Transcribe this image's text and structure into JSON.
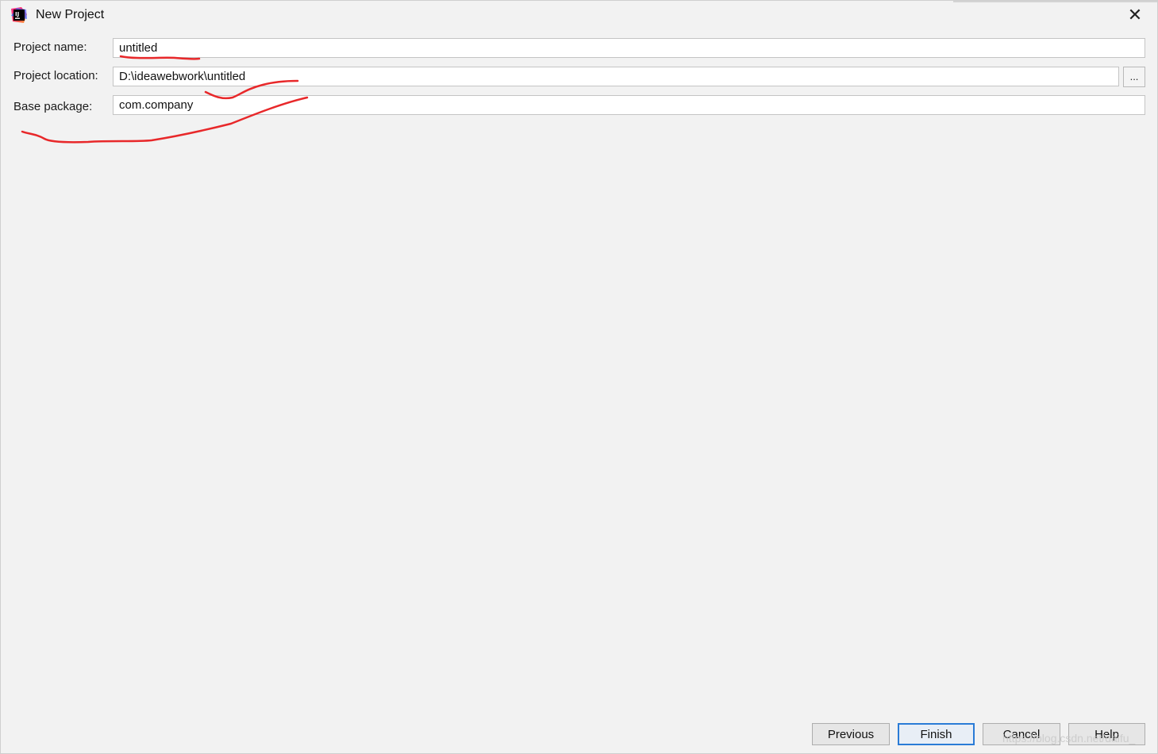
{
  "window": {
    "title": "New Project",
    "close_glyph": "✕"
  },
  "form": {
    "project_name": {
      "label": "Project name:",
      "value": "untitled"
    },
    "project_location": {
      "label": "Project location:",
      "value": "D:\\ideawebwork\\untitled",
      "browse_label": "..."
    },
    "base_package": {
      "label": "Base package:",
      "value": "com.company"
    }
  },
  "buttons": {
    "previous": "Previous",
    "finish": "Finish",
    "cancel": "Cancel",
    "help": "Help"
  },
  "watermark": "https://blog.csdn.net/daifu_",
  "colors": {
    "background": "#f2f2f2",
    "annotation": "#e8282a",
    "primary_border": "#2a7bd6"
  },
  "icons": {
    "app": "intellij-idea-icon",
    "close": "close-icon"
  }
}
